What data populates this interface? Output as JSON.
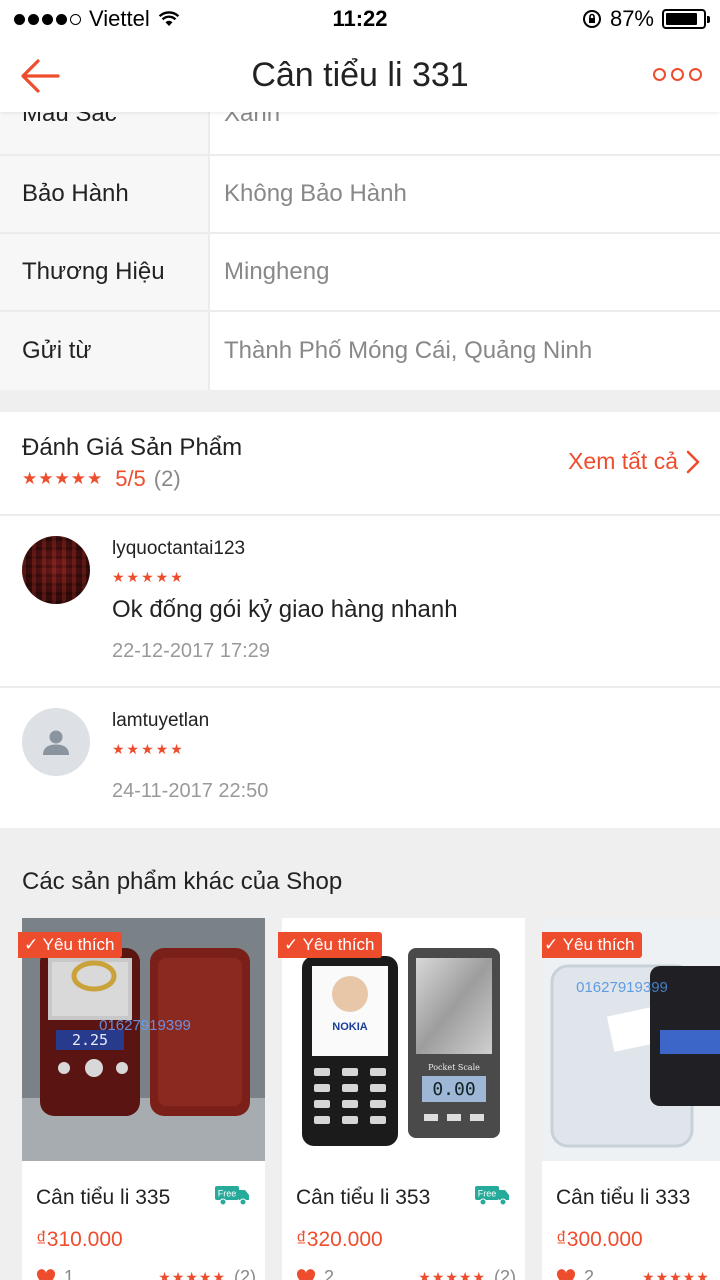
{
  "status_bar": {
    "carrier": "Viettel",
    "time": "11:22",
    "battery": "87%",
    "battery_level": 0.87
  },
  "nav": {
    "title": "Cân tiểu li 331"
  },
  "specs": [
    {
      "key": "Màu Sắc",
      "value": "Xanh"
    },
    {
      "key": "Bảo Hành",
      "value": "Không Bảo Hành"
    },
    {
      "key": "Thương Hiệu",
      "value": "Mingheng"
    },
    {
      "key": "Gửi từ",
      "value": "Thành Phố Móng Cái, Quảng Ninh"
    }
  ],
  "reviews": {
    "title": "Đánh Giá Sản Phẩm",
    "rating": "5/5",
    "count": "(2)",
    "see_all": "Xem tất cả",
    "stars": "★★★★★",
    "items": [
      {
        "user": "lyquoctantai123",
        "stars": "★★★★★",
        "text": "Ok đống gói kỷ giao hàng nhanh",
        "date": "22-12-2017 17:29"
      },
      {
        "user": "lamtuyetlan",
        "stars": "★★★★★",
        "text": "",
        "date": "24-11-2017 22:50"
      }
    ]
  },
  "shop": {
    "title": "Các sản phẩm khác của Shop",
    "products": [
      {
        "badge": "Yêu thích",
        "name": "Cân tiểu li 335",
        "price": "₫310.000",
        "likes": "1",
        "stars": "★★★★★",
        "reviews": "(2)",
        "img_phone": "01627919399",
        "img_display": "2.25"
      },
      {
        "badge": "Yêu thích",
        "name": "Cân tiểu li 353",
        "price": "₫320.000",
        "likes": "2",
        "stars": "★★★★★",
        "reviews": "(2)",
        "img_brand": "NOKIA",
        "img_display": "0.00",
        "img_label": "Pocket Scale"
      },
      {
        "badge": "Yêu thích",
        "name": "Cân tiểu li 333",
        "price": "₫300.000",
        "likes": "2",
        "stars": "★★★★★",
        "reviews": "",
        "img_phone": "01627919399"
      }
    ],
    "free_label": "Free"
  },
  "colors": {
    "accent": "#ee4d2d",
    "free_ship": "#26aa99"
  }
}
